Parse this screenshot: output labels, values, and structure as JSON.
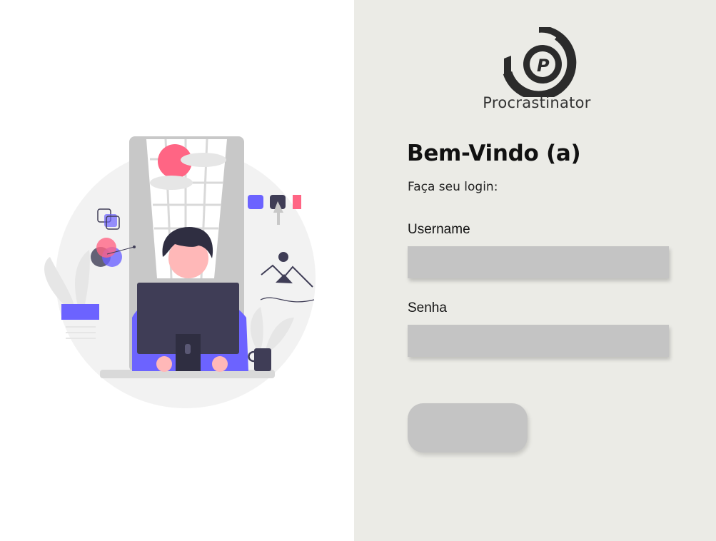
{
  "brand": {
    "name": "Procrastinator",
    "logo_letter": "P"
  },
  "login": {
    "title": "Bem-Vindo (a)",
    "subtitle": "Faça seu login:",
    "username_label": "Username",
    "username_value": "",
    "password_label": "Senha",
    "password_value": "",
    "submit_label": ""
  },
  "illustration": {
    "icon": "person-at-computer-illustration"
  },
  "colors": {
    "right_panel_bg": "#ebebe6",
    "input_bg": "#c4c4c4",
    "accent_purple": "#6c63ff",
    "accent_pink": "#ff6584",
    "dark": "#3f3d56"
  }
}
